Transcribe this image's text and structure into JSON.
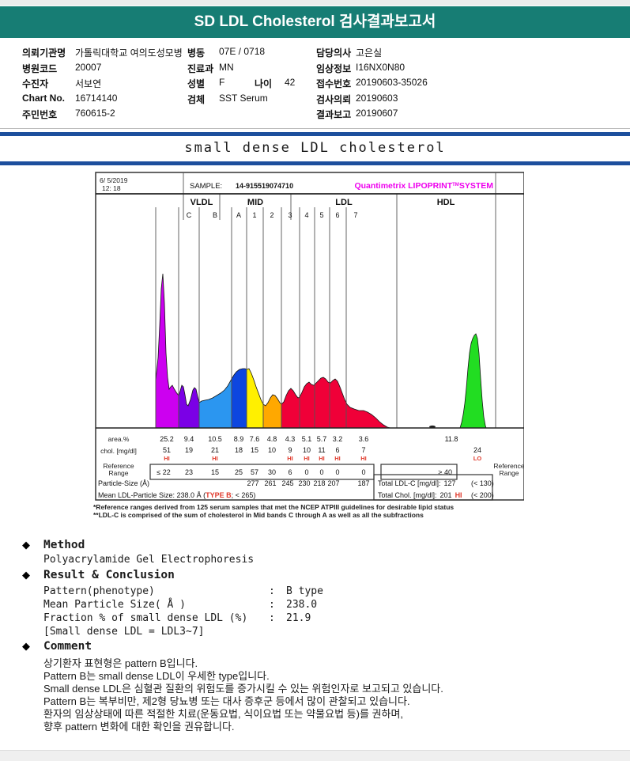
{
  "banner": {
    "title": "SD LDL Cholesterol 검사결과보고서",
    "bg": "#177d74"
  },
  "patient": {
    "org_label": "의뢰기관명",
    "org": "가톨릭대학교 여의도성모병",
    "ward_label": "병동",
    "ward": "07E / 0718",
    "hospital_code_label": "병원코드",
    "hospital_code": "20007",
    "dept_label": "진료과",
    "dept": "MN",
    "examinee_label": "수진자",
    "examinee": "서보연",
    "sex_label": "성별",
    "sex": "F",
    "age_label": "나이",
    "age": "42",
    "chart_no_label": "Chart No.",
    "chart_no": "16714140",
    "specimen_label": "검체",
    "specimen": "SST Serum",
    "resident_id_label": "주민번호",
    "resident_id": "760615-2",
    "doctor_label": "담당의사",
    "doctor": "고은실",
    "clinical_info_label": "임상정보",
    "clinical_info": "I16NX0N80",
    "accession_label": "접수번호",
    "accession": "20190603-35026",
    "request_label": "검사의뢰",
    "request_date": "20190603",
    "report_label": "결과보고",
    "report_date": "20190607"
  },
  "section_title": "small dense LDL cholesterol",
  "lipoprint": {
    "date": "6/ 5/2019",
    "time": "12: 18",
    "sample_label": "SAMPLE:",
    "sample_id": "14-915519074710",
    "brand": "Quantimetrix LIPOPRINT",
    "brand_sup": "TM",
    "brand_suffix": "SYSTEM",
    "group_vldl": "VLDL",
    "group_mid": "MID",
    "group_ldl": "LDL",
    "group_hdl": "HDL",
    "row_area_label": "area.%",
    "row_chol_label": "chol. [mg/dl]",
    "ref_label_line1": "Reference",
    "ref_label_line2": "Range",
    "row_particle_label": "Particle-Size (Å)",
    "mean_text": "Mean LDL-Particle Size:  238.0 Å  (",
    "mean_type": "TYPE B",
    "mean_tail": "; < 265)",
    "total_ldl_label": "Total LDL-C [mg/dl]:",
    "total_ldl": "127",
    "total_ldl_ref": "(< 130)",
    "total_chol_label": "Total Chol. [mg/dl]:",
    "total_chol": "201",
    "total_chol_flag": "HI",
    "total_chol_ref": "(< 200)",
    "footnote1": "*Reference ranges derived from 125 serum samples that met the NCEP ATPIII guidelines for desirable lipid status",
    "footnote2": "**LDL-C is comprised of the sum of cholesterol in Mid bands C through A as well as all the subfractions"
  },
  "chart_data": {
    "type": "area",
    "title": "Quantimetrix Lipoprint LDL subfraction electrophoresis profile",
    "bands": [
      {
        "name": "VLDL",
        "sub": "",
        "color": "#CC00F0",
        "area_pct": "25.2",
        "chol": "51",
        "flag": "HI",
        "ref": "≤ 22"
      },
      {
        "name": "MID C",
        "sub": "C",
        "color": "#7B00E6",
        "area_pct": "9.4",
        "chol": "19",
        "flag": "",
        "ref": "23"
      },
      {
        "name": "MID B",
        "sub": "B",
        "color": "#2B96F0",
        "area_pct": "10.5",
        "chol": "21",
        "flag": "HI",
        "ref": "15"
      },
      {
        "name": "MID A",
        "sub": "A",
        "color": "#0D46E0",
        "area_pct": "8.9",
        "chol": "18",
        "flag": "",
        "ref": "25"
      },
      {
        "name": "LDL 1",
        "sub": "1",
        "color": "#FFF000",
        "area_pct": "7.6",
        "chol": "15",
        "flag": "",
        "ref": "57",
        "particle_size": "277"
      },
      {
        "name": "LDL 2",
        "sub": "2",
        "color": "#FFA800",
        "area_pct": "4.8",
        "chol": "10",
        "flag": "",
        "ref": "30",
        "particle_size": "261"
      },
      {
        "name": "LDL 3",
        "sub": "3",
        "color": "#F00038",
        "area_pct": "4.3",
        "chol": "9",
        "flag": "HI",
        "ref": "6",
        "particle_size": "245"
      },
      {
        "name": "LDL 4",
        "sub": "4",
        "color": "#F00038",
        "area_pct": "5.1",
        "chol": "10",
        "flag": "HI",
        "ref": "0",
        "particle_size": "230"
      },
      {
        "name": "LDL 5",
        "sub": "5",
        "color": "#F00038",
        "area_pct": "5.7",
        "chol": "11",
        "flag": "HI",
        "ref": "0",
        "particle_size": "218"
      },
      {
        "name": "LDL 6",
        "sub": "6",
        "color": "#F00038",
        "area_pct": "3.2",
        "chol": "6",
        "flag": "HI",
        "ref": "0",
        "particle_size": "207"
      },
      {
        "name": "LDL 7",
        "sub": "7",
        "color": "#F00038",
        "area_pct": "3.6",
        "chol": "7",
        "flag": "HI",
        "ref": "0",
        "particle_size": "187"
      },
      {
        "name": "HDL",
        "sub": "",
        "color": "#22DD22",
        "area_pct": "11.8",
        "chol": "24",
        "flag": "LO",
        "ref": "≥ 40"
      }
    ],
    "mean_ldl_particle_size_A": 238.0,
    "phenotype": "TYPE B",
    "total_ldl_c": 127,
    "total_chol": 201
  },
  "sections": {
    "method_title": "Method",
    "method_body": "Polyacrylamide Gel Electrophoresis",
    "result_title": "Result & Conclusion",
    "result_rows": [
      {
        "label": "Pattern(phenotype)",
        "colon": ":",
        "value": "B type"
      },
      {
        "label": "Mean Particle Size( Å )",
        "colon": ":",
        "value": "238.0"
      },
      {
        "label": "Fraction % of small dense LDL (%)",
        "colon": ":",
        "value": "21.9"
      }
    ],
    "result_note": "[Small dense LDL = LDL3~7]",
    "comment_title": "Comment",
    "comment_lines": [
      "상기환자 표현형은 pattern B입니다.",
      "Pattern B는 small dense LDL이 우세한 type입니다.",
      "Small dense LDL은 심혈관 질환의 위험도를 증가시킬 수 있는 위험인자로 보고되고 있습니다.",
      "Pattern B는 복부비만, 제2형 당뇨병 또는 대사 증후군 등에서 많이 관찰되고 있습니다.",
      "환자의 임상상태에 따른 적절한 치료(운동요법, 식이요법 또는 약물요법 등)를 권하며,",
      "향후 pattern 변화에 대한 확인을 권유합니다."
    ]
  }
}
